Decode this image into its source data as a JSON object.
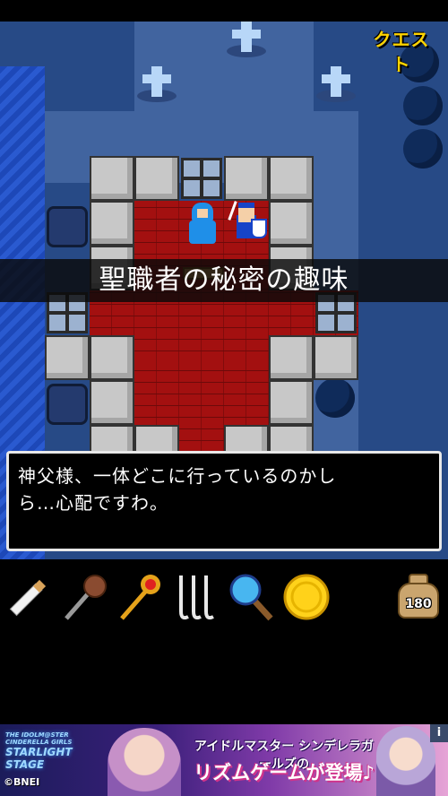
{
  "scene": {
    "quest_button": "クエスト",
    "chapter_title": "聖職者の秘密の趣味"
  },
  "dialog": {
    "text": "神父様、一体どこに行っているのかし\nら…心配ですわ。"
  },
  "inventory": {
    "items": [
      {
        "name": "cigarette-icon"
      },
      {
        "name": "mace-icon"
      },
      {
        "name": "scepter-icon"
      },
      {
        "name": "hooks-icon"
      },
      {
        "name": "magnifying-glass-icon"
      },
      {
        "name": "gold-coin-icon"
      }
    ],
    "money": "180"
  },
  "ad": {
    "logo_line1": "THE IDOLM@STER CINDERELLA GIRLS",
    "logo_line2": "STARLIGHT STAGE",
    "line1": "アイドルマスター シンデレラガールズの",
    "line2": "リズムゲームが登場♪",
    "copyright": "©BNEI",
    "info": "i"
  },
  "colors": {
    "quest": "#ffd400",
    "floor": "#a31010",
    "water": "#1d48b8",
    "ground": "#274a86"
  }
}
